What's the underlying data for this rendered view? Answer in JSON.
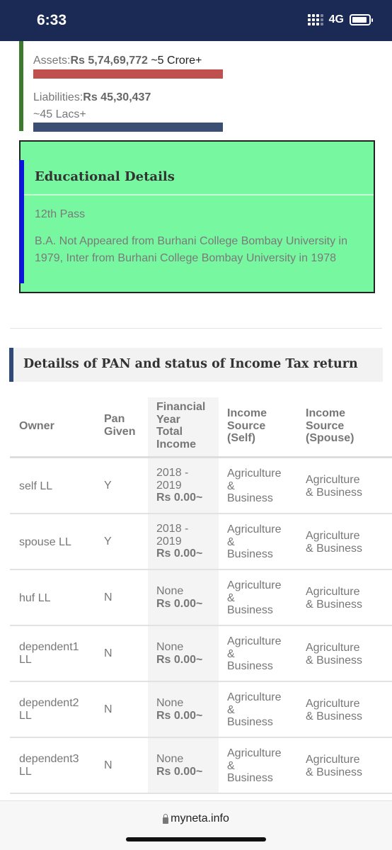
{
  "status_bar": {
    "time": "6:33",
    "network": "4G"
  },
  "assets": {
    "label": "Assets:",
    "value": "Rs 5,74,69,772",
    "approx": " ~5 Crore+",
    "bar_color": "#c0504d"
  },
  "liabilities": {
    "label": "Liabilities:",
    "value": "Rs 45,30,437",
    "approx": "~45 Lacs+",
    "bar_color": "#3b4f75"
  },
  "education": {
    "title": "Educational Details",
    "category": "12th Pass",
    "details": "B.A. Not Appeared from Burhani College Bombay University in 1979, Inter from Burhani College Bombay University in 1978",
    "bg_color": "#77f79f",
    "accent_color": "#0b14d8"
  },
  "pan_section": {
    "title": "Detailss of PAN and status of Income Tax return",
    "headers": {
      "owner": "Owner",
      "pan_given": [
        "Pan",
        "Given"
      ],
      "financial_year": [
        "Financial",
        "Year",
        "Total",
        "Income"
      ],
      "income_self": [
        "Income",
        "Source",
        "(Self)"
      ],
      "income_spouse": [
        "Income",
        "Source",
        "(Spouse)"
      ]
    },
    "rows": [
      {
        "owner": [
          "self LL"
        ],
        "pan": "Y",
        "year": [
          "2018 -",
          "2019"
        ],
        "income": "Rs 0.00~",
        "src_self": [
          "Agriculture",
          "&",
          "Business"
        ],
        "src_spouse": [
          "Agriculture",
          "& Business"
        ]
      },
      {
        "owner": [
          "spouse LL"
        ],
        "pan": "Y",
        "year": [
          "2018 -",
          "2019"
        ],
        "income": "Rs 0.00~",
        "src_self": [
          "Agriculture",
          "&",
          "Business"
        ],
        "src_spouse": [
          "Agriculture",
          "& Business"
        ]
      },
      {
        "owner": [
          "huf LL"
        ],
        "pan": "N",
        "year": [
          "None"
        ],
        "income": "Rs 0.00~",
        "src_self": [
          "Agriculture",
          "&",
          "Business"
        ],
        "src_spouse": [
          "Agriculture",
          "& Business"
        ]
      },
      {
        "owner": [
          "dependent1",
          "LL"
        ],
        "pan": "N",
        "year": [
          "None"
        ],
        "income": "Rs 0.00~",
        "src_self": [
          "Agriculture",
          "&",
          "Business"
        ],
        "src_spouse": [
          "Agriculture",
          "& Business"
        ]
      },
      {
        "owner": [
          "dependent2",
          "LL"
        ],
        "pan": "N",
        "year": [
          "None"
        ],
        "income": "Rs 0.00~",
        "src_self": [
          "Agriculture",
          "&",
          "Business"
        ],
        "src_spouse": [
          "Agriculture",
          "& Business"
        ]
      },
      {
        "owner": [
          "dependent3",
          "LL"
        ],
        "pan": "N",
        "year": [
          "None"
        ],
        "income": "Rs 0.00~",
        "src_self": [
          "Agriculture",
          "&",
          "Business"
        ],
        "src_spouse": [
          "Agriculture",
          "& Business"
        ]
      }
    ]
  },
  "browser": {
    "url": "myneta.info"
  }
}
